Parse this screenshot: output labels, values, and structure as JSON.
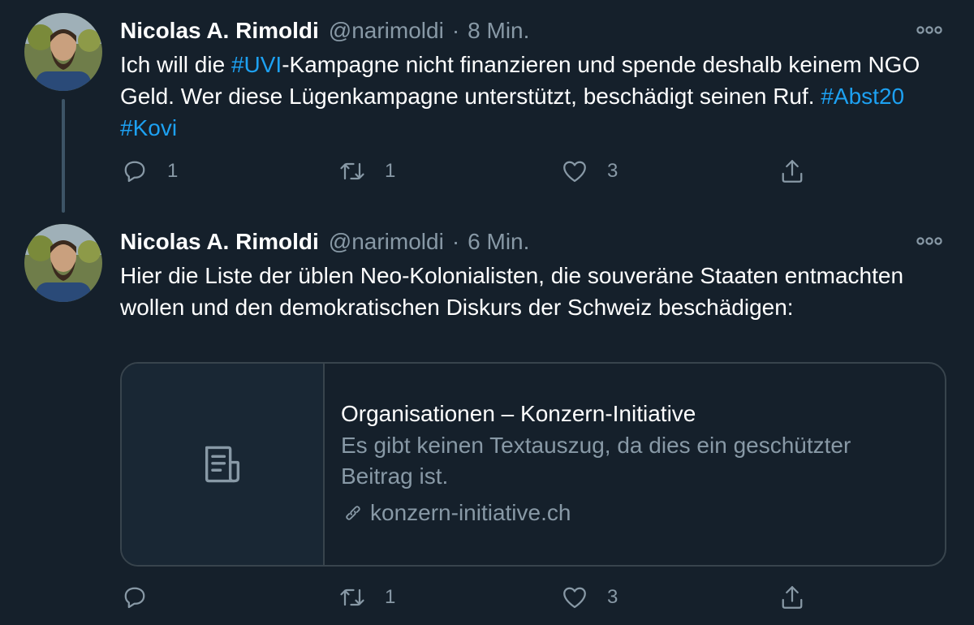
{
  "tweets": [
    {
      "author_name": "Nicolas A. Rimoldi",
      "handle": "@narimoldi",
      "separator": "·",
      "time": "8 Min.",
      "text_parts": [
        "Ich will die ",
        "#UVI",
        "-Kampagne nicht finanzieren und spende deshalb keinem NGO Geld. Wer diese Lügenkampagne unterstützt, beschädigt seinen Ruf. ",
        "#Abst20",
        " ",
        "#Kovi"
      ],
      "reply_count": "1",
      "retweet_count": "1",
      "like_count": "3"
    },
    {
      "author_name": "Nicolas A. Rimoldi",
      "handle": "@narimoldi",
      "separator": "·",
      "time": "6 Min.",
      "text": "Hier die Liste der üblen Neo-Kolonialisten, die souveräne Staaten entmachten wollen und den demokratischen Diskurs der Schweiz beschädigen:",
      "link_card": {
        "title": "Organisationen – Konzern-Initiative",
        "description": "Es gibt keinen Textauszug, da dies ein geschützter Beitrag ist.",
        "domain": "konzern-initiative.ch"
      },
      "reply_count": "",
      "retweet_count": "1",
      "like_count": "3"
    }
  ],
  "icons": {
    "more": "more-horizontal-icon",
    "reply": "reply-icon",
    "retweet": "retweet-icon",
    "like": "heart-icon",
    "share": "share-icon",
    "card_thumb": "document-icon",
    "link": "link-icon"
  },
  "colors": {
    "background": "#15202b",
    "text_primary": "#ffffff",
    "text_secondary": "#8899a6",
    "accent": "#1da1f2",
    "border": "#38444d"
  }
}
